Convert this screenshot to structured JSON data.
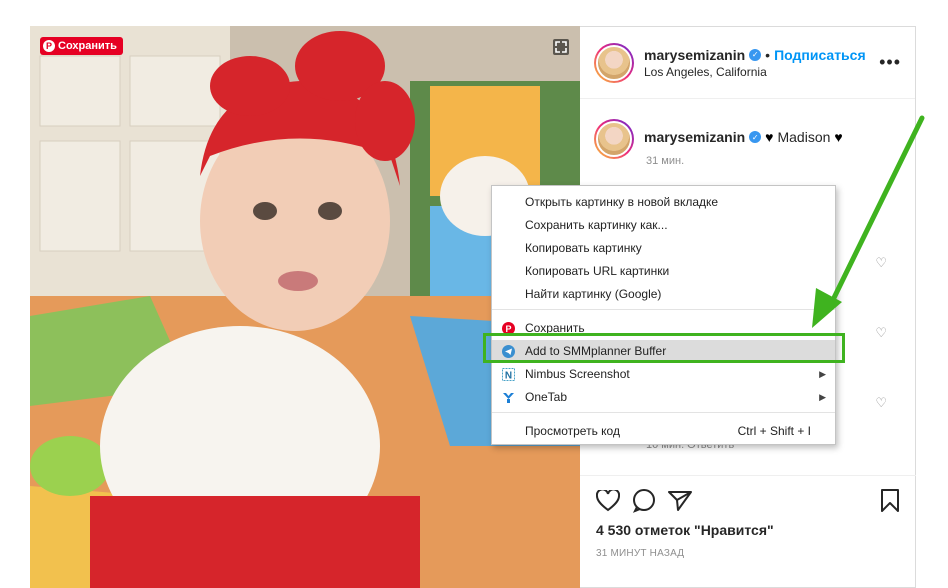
{
  "photo": {
    "pin_save_label": "Сохранить",
    "pin_logo": "P",
    "expand_icon": "expand-icon"
  },
  "post": {
    "username": "marysemizanin",
    "follow_label": "Подписаться",
    "separator": "•",
    "location": "Los Angeles, California",
    "more_label": "•••",
    "caption_text": "Madison",
    "caption_time": "31 мин.",
    "comment_time": "10 мин.  Ответить",
    "likes": "4 530 отметок \"Нравится\"",
    "timestamp": "31 МИНУТ НАЗАД"
  },
  "context_menu": {
    "items": [
      {
        "label": "Открыть картинку в новой вкладке"
      },
      {
        "label": "Сохранить картинку как..."
      },
      {
        "label": "Копировать картинку"
      },
      {
        "label": "Копировать URL картинки"
      },
      {
        "label": "Найти картинку (Google)"
      },
      {
        "label": "Сохранить",
        "icon": "pinterest-icon"
      },
      {
        "label": "Add to SMMplanner Buffer",
        "icon": "telegram-icon",
        "highlighted": true
      },
      {
        "label": "Nimbus Screenshot",
        "icon": "nimbus-icon",
        "submenu": true
      },
      {
        "label": "OneTab",
        "icon": "onetab-icon",
        "submenu": true
      },
      {
        "label": "Просмотреть код",
        "shortcut": "Ctrl + Shift + I"
      }
    ]
  },
  "colors": {
    "accent": "#0095f6",
    "pinterest": "#e60023",
    "annotation": "#3fb31f",
    "headband": "#d6252b"
  }
}
